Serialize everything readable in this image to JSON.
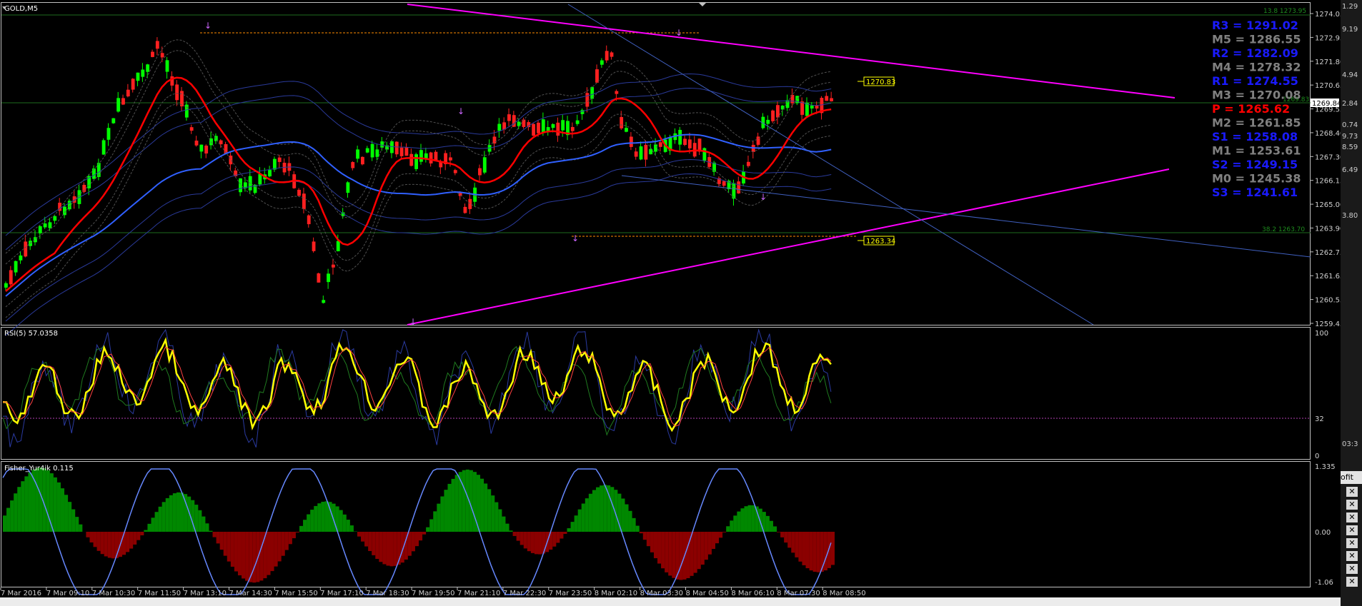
{
  "main_chart": {
    "title": "GOLD,M5",
    "price_ticks": [
      "1274.05",
      "1272.95",
      "1271.80",
      "1270.65",
      "1269.55",
      "1268.40",
      "1267.30",
      "1266.15",
      "1265.00",
      "1263.90",
      "1262.75",
      "1261.65",
      "1260.55",
      "1259.45"
    ],
    "current_price": "1269.84",
    "label_upper_fib": "13.8  1273.95",
    "label_mid_fib": "1269.83",
    "label_lower_fib": "38.2  1263.70",
    "price_box_upper": "1270.83",
    "price_box_lower": "1263.34",
    "pivots": [
      {
        "label": "R3 = 1291.02",
        "color": "#1a1aff"
      },
      {
        "label": "M5 = 1286.55",
        "color": "#808080"
      },
      {
        "label": "R2 = 1282.09",
        "color": "#1a1aff"
      },
      {
        "label": "M4 = 1278.32",
        "color": "#808080"
      },
      {
        "label": "R1 = 1274.55",
        "color": "#1a1aff"
      },
      {
        "label": "M3 = 1270.08",
        "color": "#808080"
      },
      {
        "label": "P   = 1265.62",
        "color": "#ff0000"
      },
      {
        "label": "M2 = 1261.85",
        "color": "#808080"
      },
      {
        "label": "S1 = 1258.08",
        "color": "#1a1aff"
      },
      {
        "label": "M1 = 1253.61",
        "color": "#808080"
      },
      {
        "label": "S2 = 1249.15",
        "color": "#1a1aff"
      },
      {
        "label": "M0 = 1245.38",
        "color": "#808080"
      },
      {
        "label": "S3 = 1241.61",
        "color": "#1a1aff"
      }
    ]
  },
  "rsi_pane": {
    "title": "RSI(5) 57.0358",
    "ticks": [
      "100",
      "32",
      "0"
    ]
  },
  "fisher_pane": {
    "title": "Fisher_Yur4ik 0.115",
    "ticks": [
      "1.335",
      "0.00",
      "-1.06"
    ]
  },
  "time_axis": [
    "7 Mar 2016",
    "7 Mar 09:10",
    "7 Mar 10:30",
    "7 Mar 11:50",
    "7 Mar 13:10",
    "7 Mar 14:30",
    "7 Mar 15:50",
    "7 Mar 17:10",
    "7 Mar 18:30",
    "7 Mar 19:50",
    "7 Mar 21:10",
    "7 Mar 22:30",
    "7 Mar 23:50",
    "8 Mar 02:10",
    "8 Mar 03:30",
    "8 Mar 04:50",
    "8 Mar 06:10",
    "8 Mar 07:30",
    "8 Mar 08:50"
  ],
  "side_panel": {
    "values": [
      "1.29",
      "9.19",
      "4.94",
      "2.84",
      "0.74",
      "9.73",
      "8.59",
      "6.49",
      "3.80",
      "03:3"
    ],
    "tab_label": "ofit"
  },
  "colors": {
    "bull": "#00ff00",
    "bear": "#ff2020",
    "ema_red": "#ff0000",
    "ema_blue": "#3060ff",
    "trendline": "#ff00ff",
    "rsi": "#ffff00",
    "fisher_pos": "#008800",
    "fisher_neg": "#8b0000",
    "fisher_line": "#6688ff"
  }
}
